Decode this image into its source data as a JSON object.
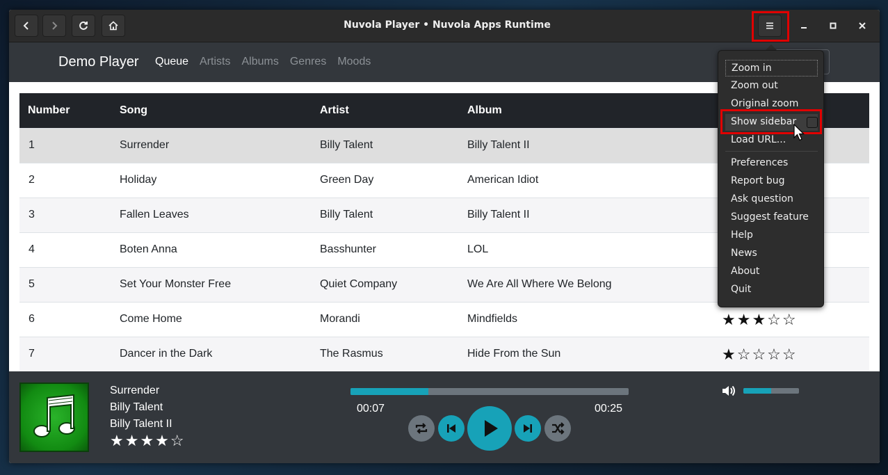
{
  "window": {
    "title": "Nuvola Player • Nuvola Apps Runtime"
  },
  "header": {
    "back_icon": "chevron-left-icon",
    "forward_icon": "chevron-right-icon",
    "reload_icon": "reload-icon",
    "home_icon": "home-icon",
    "menu_icon": "hamburger-menu-icon"
  },
  "navbar": {
    "brand": "Demo Player",
    "links": [
      "Queue",
      "Artists",
      "Albums",
      "Genres",
      "Moods"
    ],
    "active_link": "Queue"
  },
  "table": {
    "headers": [
      "Number",
      "Song",
      "Artist",
      "Album"
    ],
    "rows": [
      {
        "number": "1",
        "song": "Surrender",
        "artist": "Billy Talent",
        "album": "Billy Talent II",
        "rating": null
      },
      {
        "number": "2",
        "song": "Holiday",
        "artist": "Green Day",
        "album": "American Idiot",
        "rating": null
      },
      {
        "number": "3",
        "song": "Fallen Leaves",
        "artist": "Billy Talent",
        "album": "Billy Talent II",
        "rating": null
      },
      {
        "number": "4",
        "song": "Boten Anna",
        "artist": "Basshunter",
        "album": "LOL",
        "rating": null
      },
      {
        "number": "5",
        "song": "Set Your Monster Free",
        "artist": "Quiet Company",
        "album": "We Are All Where We Belong",
        "rating": null
      },
      {
        "number": "6",
        "song": "Come Home",
        "artist": "Morandi",
        "album": "Mindfields",
        "rating": 3
      },
      {
        "number": "7",
        "song": "Dancer in the Dark",
        "artist": "The Rasmus",
        "album": "Hide From the Sun",
        "rating": 1
      }
    ]
  },
  "player": {
    "album_art_icon": "music-note-icon",
    "song": "Surrender",
    "artist": "Billy Talent",
    "album": "Billy Talent II",
    "rating": 4,
    "rating_max": 5,
    "progress_fraction": 0.28,
    "elapsed": "00:07",
    "duration": "00:25",
    "volume_fraction": 0.5,
    "colors": {
      "accent": "#17a2b8",
      "bar_bg": "#6c757d",
      "panel": "#33373c"
    }
  },
  "menu": {
    "items": [
      "Zoom in",
      "Zoom out",
      "Original zoom",
      "Show sidebar",
      "Load URL...",
      "Preferences",
      "Report bug",
      "Ask question",
      "Suggest feature",
      "Help",
      "News",
      "About",
      "Quit"
    ],
    "show_sidebar_checked": false
  }
}
